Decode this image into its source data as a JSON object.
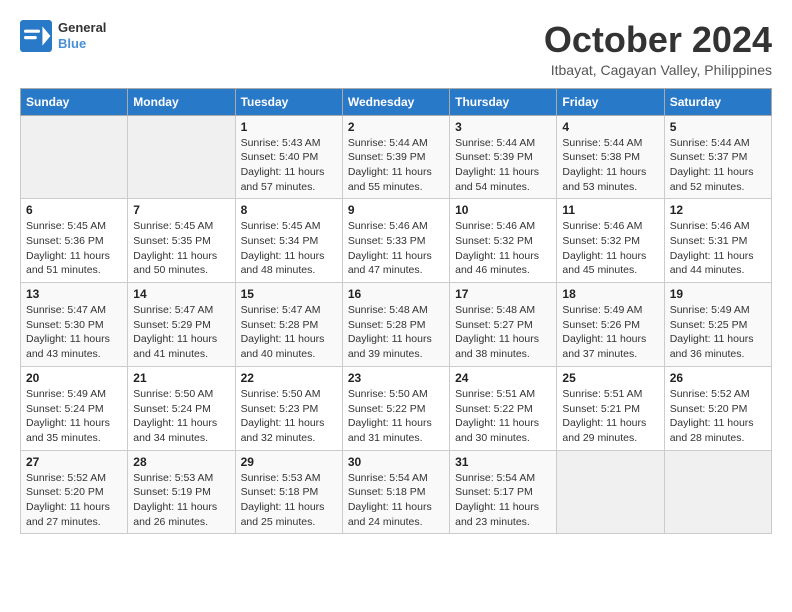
{
  "header": {
    "logo": {
      "line1": "General",
      "line2": "Blue"
    },
    "title": "October 2024",
    "subtitle": "Itbayat, Cagayan Valley, Philippines"
  },
  "weekdays": [
    "Sunday",
    "Monday",
    "Tuesday",
    "Wednesday",
    "Thursday",
    "Friday",
    "Saturday"
  ],
  "weeks": [
    [
      {
        "day": "",
        "info": ""
      },
      {
        "day": "",
        "info": ""
      },
      {
        "day": "1",
        "info": "Sunrise: 5:43 AM\nSunset: 5:40 PM\nDaylight: 11 hours and 57 minutes."
      },
      {
        "day": "2",
        "info": "Sunrise: 5:44 AM\nSunset: 5:39 PM\nDaylight: 11 hours and 55 minutes."
      },
      {
        "day": "3",
        "info": "Sunrise: 5:44 AM\nSunset: 5:39 PM\nDaylight: 11 hours and 54 minutes."
      },
      {
        "day": "4",
        "info": "Sunrise: 5:44 AM\nSunset: 5:38 PM\nDaylight: 11 hours and 53 minutes."
      },
      {
        "day": "5",
        "info": "Sunrise: 5:44 AM\nSunset: 5:37 PM\nDaylight: 11 hours and 52 minutes."
      }
    ],
    [
      {
        "day": "6",
        "info": "Sunrise: 5:45 AM\nSunset: 5:36 PM\nDaylight: 11 hours and 51 minutes."
      },
      {
        "day": "7",
        "info": "Sunrise: 5:45 AM\nSunset: 5:35 PM\nDaylight: 11 hours and 50 minutes."
      },
      {
        "day": "8",
        "info": "Sunrise: 5:45 AM\nSunset: 5:34 PM\nDaylight: 11 hours and 48 minutes."
      },
      {
        "day": "9",
        "info": "Sunrise: 5:46 AM\nSunset: 5:33 PM\nDaylight: 11 hours and 47 minutes."
      },
      {
        "day": "10",
        "info": "Sunrise: 5:46 AM\nSunset: 5:32 PM\nDaylight: 11 hours and 46 minutes."
      },
      {
        "day": "11",
        "info": "Sunrise: 5:46 AM\nSunset: 5:32 PM\nDaylight: 11 hours and 45 minutes."
      },
      {
        "day": "12",
        "info": "Sunrise: 5:46 AM\nSunset: 5:31 PM\nDaylight: 11 hours and 44 minutes."
      }
    ],
    [
      {
        "day": "13",
        "info": "Sunrise: 5:47 AM\nSunset: 5:30 PM\nDaylight: 11 hours and 43 minutes."
      },
      {
        "day": "14",
        "info": "Sunrise: 5:47 AM\nSunset: 5:29 PM\nDaylight: 11 hours and 41 minutes."
      },
      {
        "day": "15",
        "info": "Sunrise: 5:47 AM\nSunset: 5:28 PM\nDaylight: 11 hours and 40 minutes."
      },
      {
        "day": "16",
        "info": "Sunrise: 5:48 AM\nSunset: 5:28 PM\nDaylight: 11 hours and 39 minutes."
      },
      {
        "day": "17",
        "info": "Sunrise: 5:48 AM\nSunset: 5:27 PM\nDaylight: 11 hours and 38 minutes."
      },
      {
        "day": "18",
        "info": "Sunrise: 5:49 AM\nSunset: 5:26 PM\nDaylight: 11 hours and 37 minutes."
      },
      {
        "day": "19",
        "info": "Sunrise: 5:49 AM\nSunset: 5:25 PM\nDaylight: 11 hours and 36 minutes."
      }
    ],
    [
      {
        "day": "20",
        "info": "Sunrise: 5:49 AM\nSunset: 5:24 PM\nDaylight: 11 hours and 35 minutes."
      },
      {
        "day": "21",
        "info": "Sunrise: 5:50 AM\nSunset: 5:24 PM\nDaylight: 11 hours and 34 minutes."
      },
      {
        "day": "22",
        "info": "Sunrise: 5:50 AM\nSunset: 5:23 PM\nDaylight: 11 hours and 32 minutes."
      },
      {
        "day": "23",
        "info": "Sunrise: 5:50 AM\nSunset: 5:22 PM\nDaylight: 11 hours and 31 minutes."
      },
      {
        "day": "24",
        "info": "Sunrise: 5:51 AM\nSunset: 5:22 PM\nDaylight: 11 hours and 30 minutes."
      },
      {
        "day": "25",
        "info": "Sunrise: 5:51 AM\nSunset: 5:21 PM\nDaylight: 11 hours and 29 minutes."
      },
      {
        "day": "26",
        "info": "Sunrise: 5:52 AM\nSunset: 5:20 PM\nDaylight: 11 hours and 28 minutes."
      }
    ],
    [
      {
        "day": "27",
        "info": "Sunrise: 5:52 AM\nSunset: 5:20 PM\nDaylight: 11 hours and 27 minutes."
      },
      {
        "day": "28",
        "info": "Sunrise: 5:53 AM\nSunset: 5:19 PM\nDaylight: 11 hours and 26 minutes."
      },
      {
        "day": "29",
        "info": "Sunrise: 5:53 AM\nSunset: 5:18 PM\nDaylight: 11 hours and 25 minutes."
      },
      {
        "day": "30",
        "info": "Sunrise: 5:54 AM\nSunset: 5:18 PM\nDaylight: 11 hours and 24 minutes."
      },
      {
        "day": "31",
        "info": "Sunrise: 5:54 AM\nSunset: 5:17 PM\nDaylight: 11 hours and 23 minutes."
      },
      {
        "day": "",
        "info": ""
      },
      {
        "day": "",
        "info": ""
      }
    ]
  ]
}
